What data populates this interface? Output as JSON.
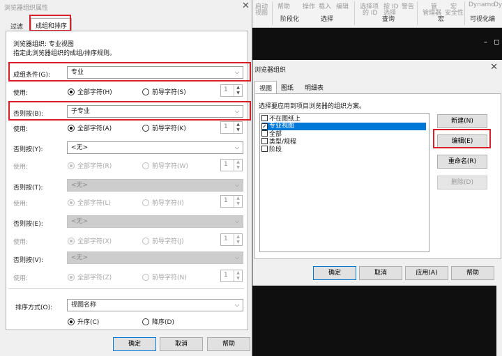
{
  "ribbon": {
    "top_labels": [
      "启动",
      "视图",
      "帮助",
      "操作",
      "载入",
      "编辑",
      "选择项",
      "按 ID",
      "警告",
      "管",
      "宏",
      "Dynamo",
      "Dy"
    ],
    "top_labels_2": [
      "的 ID",
      "选择",
      "管理器",
      "安全性"
    ],
    "groups": [
      "阶段化",
      "选择",
      "查询",
      "宏",
      "可视化编"
    ]
  },
  "window_controls": "– ◻",
  "left_dialog": {
    "title": "浏览器组织属性",
    "tabs": [
      "过滤",
      "成组和排序"
    ],
    "org_line": "浏览器组织: 专业视图",
    "description": "指定此浏览器组织的成组/排序规则。",
    "group_by_label": "成组条件(G):",
    "group_by_value": "专业",
    "use_label": "使用:",
    "radio_all": "全部字符(H)",
    "radio_leading": "前导字符(S)",
    "spin_value": "1",
    "then_rows": [
      {
        "label": "否则按(B):",
        "value": "子专业",
        "all": "全部字符(A)",
        "leading": "前导字符(K)",
        "spin": "1"
      },
      {
        "label": "否则按(Y):",
        "value": "<无>",
        "all": "全部字符(R)",
        "leading": "前导字符(W)",
        "spin": "1"
      },
      {
        "label": "否则按(T):",
        "value": "<无>",
        "all": "全部字符(L)",
        "leading": "前导字符(I)",
        "spin": "1"
      },
      {
        "label": "否则按(E):",
        "value": "<无>",
        "all": "全部字符(X)",
        "leading": "前导字符(J)",
        "spin": "1"
      },
      {
        "label": "否则按(V):",
        "value": "<无>",
        "all": "全部字符(Z)",
        "leading": "前导字符(N)",
        "spin": "1"
      }
    ],
    "sort_label": "排序方式(O):",
    "sort_value": "视图名称",
    "radio_asc": "升序(C)",
    "radio_desc": "降序(D)",
    "buttons": {
      "ok": "确定",
      "cancel": "取消",
      "help": "帮助"
    },
    "close": "✕"
  },
  "right_dialog": {
    "title": "浏览器组织",
    "tabs": [
      "视图",
      "图纸",
      "明细表"
    ],
    "instruction": "选择要应用到项目浏览器的组织方案。",
    "schemes": [
      {
        "label": "不在图纸上",
        "checked": false,
        "selected": false
      },
      {
        "label": "专业视图",
        "checked": true,
        "selected": true
      },
      {
        "label": "全部",
        "checked": false,
        "selected": false
      },
      {
        "label": "类型/规程",
        "checked": false,
        "selected": false
      },
      {
        "label": "阶段",
        "checked": false,
        "selected": false
      }
    ],
    "side_buttons": {
      "new": "新建(N)",
      "edit": "编辑(E)",
      "rename": "重命名(R)",
      "delete": "删除(D)"
    },
    "buttons": {
      "ok": "确定",
      "cancel": "取消",
      "apply": "应用(A)",
      "help": "帮助"
    },
    "close": "✕"
  },
  "icons": {
    "check": "✓",
    "arrow": "⌵",
    "up": "▲",
    "down": "▼"
  },
  "colors": {
    "highlight": "#d9202a",
    "selection": "#0078d7"
  }
}
